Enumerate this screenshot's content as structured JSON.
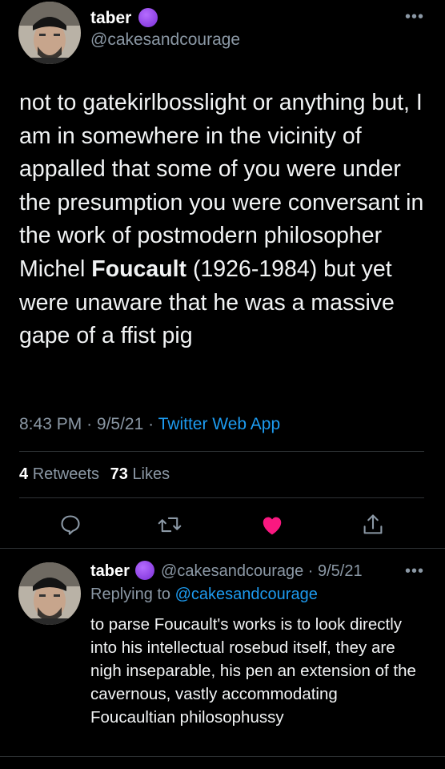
{
  "colors": {
    "background": "#000000",
    "text": "#e7e9ea",
    "muted": "#8b98a5",
    "link": "#1d9bf0",
    "like": "#f91880",
    "badge": "#8e3fe8"
  },
  "main_tweet": {
    "display_name": "taber",
    "handle": "@cakesandcourage",
    "more_label": "•••",
    "text_part1": "not to gatekirlbosslight or anything but, I am in somewhere in the vicinity of appalled that some of you were under the presumption you were conversant in the work of postmodern philosopher Michel ",
    "text_bold": "Foucault",
    "text_part2": " (1926-1984) but yet were unaware that he was a massive gape of a ffist pig",
    "time": "8:43 PM",
    "sep1": "·",
    "date": "9/5/21",
    "sep2": "·",
    "source": "Twitter Web App",
    "retweets_count": "4",
    "retweets_label": "Retweets",
    "likes_count": "73",
    "likes_label": "Likes"
  },
  "actions": [
    "reply-icon",
    "retweet-icon",
    "like-icon",
    "share-icon"
  ],
  "reply_tweet": {
    "display_name": "taber",
    "handle_date": "@cakesandcourage · 9/5/21",
    "more_label": "•••",
    "replying_prefix": "Replying to ",
    "replying_handle": "@cakesandcourage",
    "text": "to parse Foucault's works is to look directly into his intellectual rosebud itself, they are nigh inseparable, his pen an extension of the cavernous, vastly accommodating Foucaultian philosophussy"
  }
}
